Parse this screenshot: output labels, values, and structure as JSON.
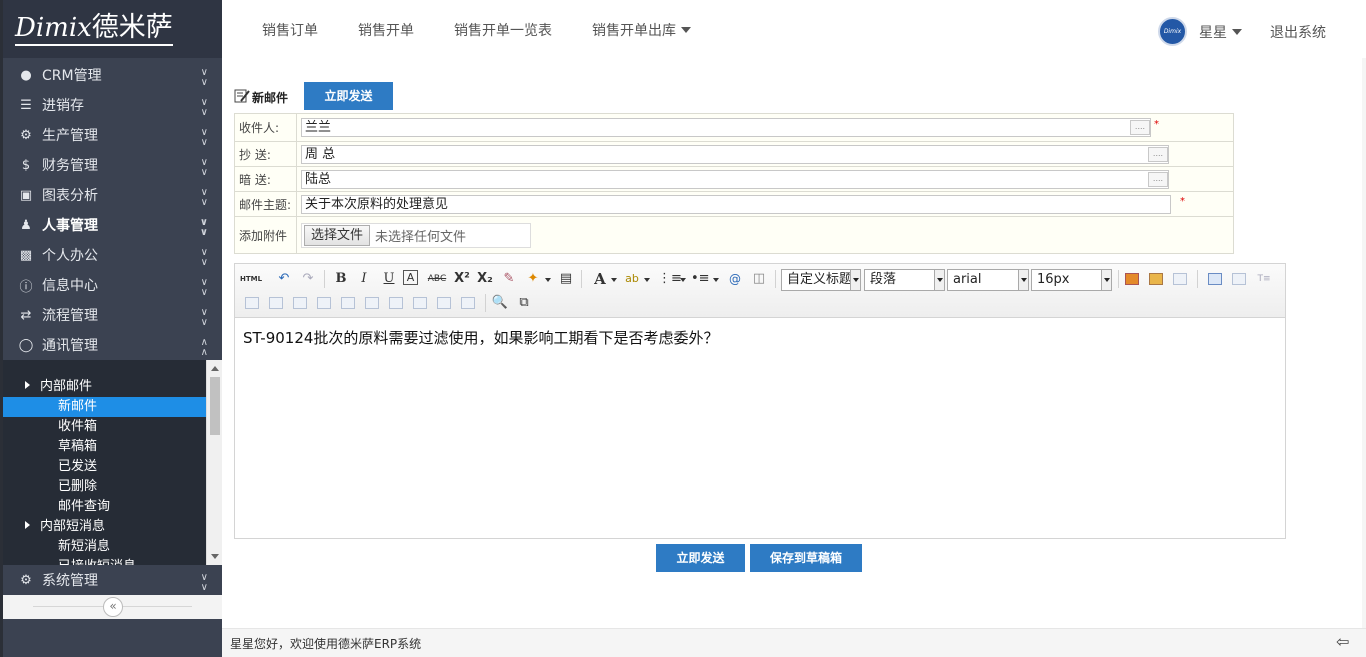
{
  "logo": {
    "latin": "Dimix",
    "cn": "德米萨"
  },
  "sidebar": {
    "items": [
      {
        "label": "CRM管理",
        "icon": "user-icon"
      },
      {
        "label": "进销存",
        "icon": "list-icon"
      },
      {
        "label": "生产管理",
        "icon": "cogs-icon"
      },
      {
        "label": "财务管理",
        "icon": "dollar-icon"
      },
      {
        "label": "图表分析",
        "icon": "picture-icon"
      },
      {
        "label": "人事管理",
        "icon": "users-icon"
      },
      {
        "label": "个人办公",
        "icon": "briefcase-icon"
      },
      {
        "label": "信息中心",
        "icon": "info-icon"
      },
      {
        "label": "流程管理",
        "icon": "exchange-icon"
      },
      {
        "label": "通讯管理",
        "icon": "comment-icon"
      }
    ],
    "sub_groups": [
      {
        "label": "内部邮件",
        "items": [
          "新邮件",
          "收件箱",
          "草稿箱",
          "已发送",
          "已删除",
          "邮件查询"
        ]
      },
      {
        "label": "内部短消息",
        "items": [
          "新短消息",
          "已接收短消息"
        ]
      }
    ],
    "system": {
      "label": "系统管理",
      "icon": "gear-icon"
    },
    "collapse_glyph": "«"
  },
  "topnav": {
    "links": [
      "销售订单",
      "销售开单",
      "销售开单一览表",
      "销售开单出库"
    ],
    "user": "星星",
    "avatar_text": "Dimix",
    "logout": "退出系统"
  },
  "compose": {
    "title": "新邮件",
    "send_label": "立即发送",
    "fields": {
      "to_label": "收件人:",
      "to_value": "兰兰",
      "cc_label": "抄 送:",
      "cc_value": "周 总",
      "bcc_label": "暗 送:",
      "bcc_value": "陆总",
      "subject_label": "邮件主题:",
      "subject_value": "关于本次原料的处理意见",
      "attach_label": "添加附件",
      "file_button": "选择文件",
      "file_status": "未选择任何文件",
      "required_mark": "*",
      "pick_glyph": "...."
    },
    "editor": {
      "html_label": "HTML",
      "heading_select": "自定义标题",
      "paragraph_select": "段落",
      "font_select": "arial",
      "size_select": "16px",
      "body": "ST-90124批次的原料需要过滤使用，如果影响工期看下是否考虑委外？"
    },
    "send_bottom": "立即发送",
    "save_draft": "保存到草稿箱"
  },
  "footer": {
    "text": "星星您好，欢迎使用德米萨ERP系统"
  }
}
